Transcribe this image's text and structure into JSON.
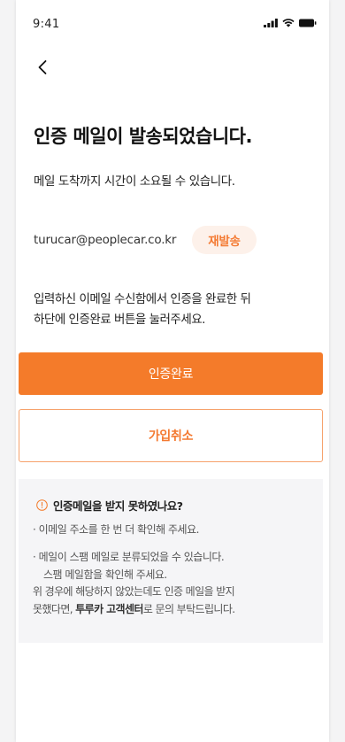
{
  "status_bar": {
    "time": "9:41"
  },
  "header": {
    "back_icon": "chevron-left-icon"
  },
  "title": "인증 메일이 발송되었습니다.",
  "subtitle": "메일 도착까지 시간이 소요될 수 있습니다.",
  "email": {
    "address": "turucar@peoplecar.co.kr",
    "resend_label": "재발송"
  },
  "instruction": {
    "line1": "입력하신 이메일 수신함에서 인증을 완료한 뒤",
    "line2": "하단에 인증완료 버튼을 눌러주세요."
  },
  "buttons": {
    "confirm_label": "인증완료",
    "cancel_label": "가입취소"
  },
  "notice": {
    "icon": "info-circle-icon",
    "title": "인증메일을 받지 못하였나요?",
    "bullet1": "· 이메일 주소를 한 번 더 확인해 주세요.",
    "bullet2_line1": "· 메일이 스팸 메일로 분류되었을 수 있습니다.",
    "bullet2_line2": "스팸 메일함을 확인해 주세요.",
    "footer_line1": "위 경우에 해당하지 않았는데도 인증 메일을 받지",
    "footer_line2_pre": "못했다면, ",
    "footer_line2_bold": "투루카 고객센터",
    "footer_line2_post": "로 문의 부탁드립니다."
  },
  "colors": {
    "accent": "#f47b2a",
    "accent_light": "#fdf1ea",
    "notice_bg": "#f5f5f7"
  }
}
